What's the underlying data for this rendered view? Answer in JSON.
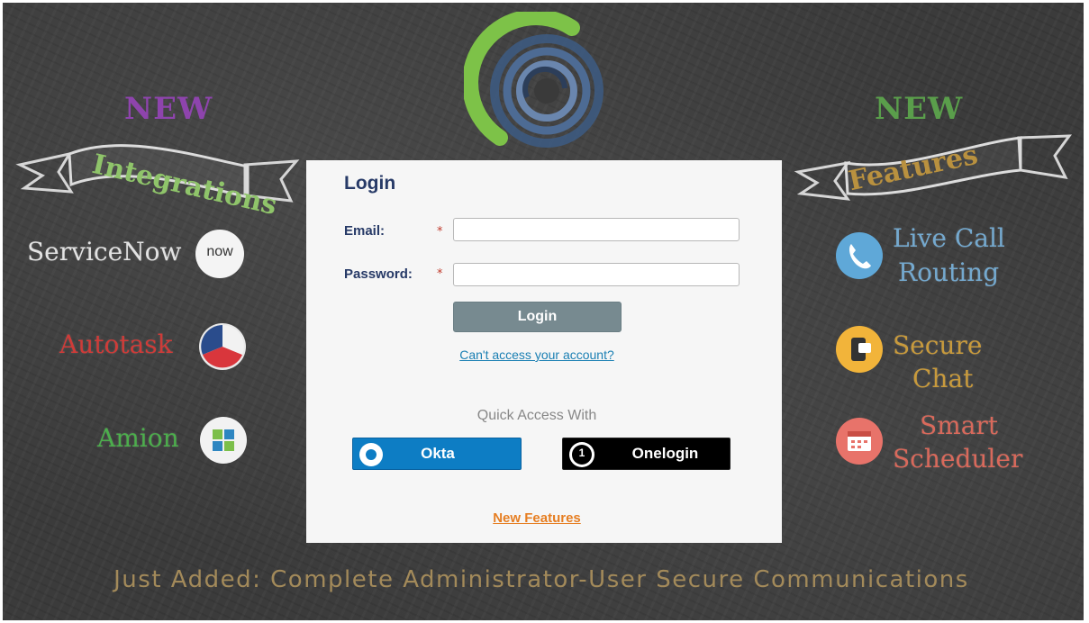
{
  "left_panel": {
    "new_label": "NEW",
    "banner_text": "Integrations",
    "items": [
      {
        "label": "ServiceNow",
        "icon": "servicenow-icon",
        "icon_text": "now"
      },
      {
        "label": "Autotask",
        "icon": "autotask-icon"
      },
      {
        "label": "Amion",
        "icon": "amion-icon"
      }
    ]
  },
  "right_panel": {
    "new_label": "NEW",
    "banner_text": "Features",
    "items": [
      {
        "label_line1": "Live Call",
        "label_line2": "Routing",
        "icon": "phone-icon"
      },
      {
        "label_line1": "Secure",
        "label_line2": "Chat",
        "icon": "secure-chat-icon"
      },
      {
        "label_line1": "Smart",
        "label_line2": "Scheduler",
        "icon": "calendar-icon"
      }
    ]
  },
  "login": {
    "title": "Login",
    "email_label": "Email:",
    "email_value": "",
    "password_label": "Password:",
    "password_value": "",
    "required_mark": "*",
    "login_button": "Login",
    "forgot_link": "Can't access your account?",
    "quick_access_label": "Quick Access With",
    "okta_label": "Okta",
    "onelogin_label": "Onelogin",
    "onelogin_badge": "1",
    "new_features_link": "New Features"
  },
  "footer": {
    "text": "Just Added: Complete Administrator-User Secure Communications"
  },
  "colors": {
    "chalkboard": "#3b3b3b",
    "login_title": "#273a67",
    "login_button": "#778a90",
    "link": "#1a7fb3",
    "new_features": "#e67e22",
    "okta": "#0d7dc4",
    "onelogin": "#000000",
    "footer": "#a38a5a",
    "new_left": "#8e44ad",
    "new_right": "#5a9e4b"
  }
}
